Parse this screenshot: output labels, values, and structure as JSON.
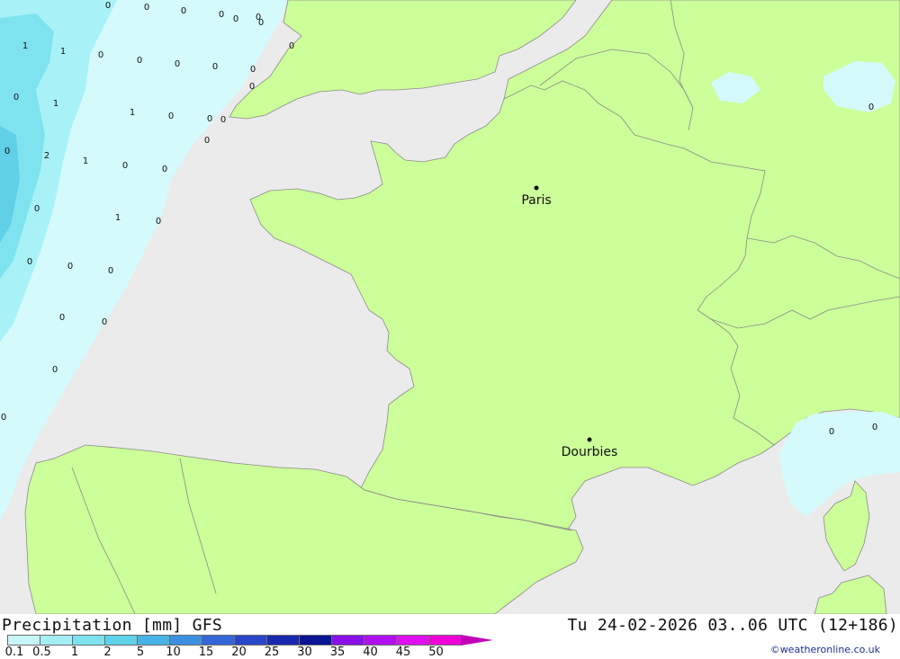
{
  "map": {
    "colors": {
      "sea": "#ebebeb",
      "land": "#ccff99",
      "precip_0_1": "#d4fafc",
      "precip_0_5": "#a8f2f7",
      "precip_1": "#7fe3ef",
      "precip_2": "#5fd0e6",
      "border": "#8a8a8a"
    },
    "cities": [
      {
        "name": "Paris"
      },
      {
        "name": "Dourbies"
      }
    ],
    "precip_values": [
      "0",
      "0",
      "0",
      "0",
      "0",
      "0",
      "1",
      "1",
      "0",
      "0",
      "0",
      "0",
      "0",
      "1",
      "1",
      "0",
      "0",
      "0",
      "2",
      "1",
      "0",
      "0",
      "0",
      "1",
      "0",
      "0",
      "0",
      "0",
      "0",
      "0",
      "0",
      "0",
      "0",
      "0",
      "0",
      "0",
      "0",
      "0",
      "0",
      "0",
      "0"
    ]
  },
  "legend": {
    "title": "Precipitation [mm] GFS",
    "time": "Tu 24-02-2026 03..06 UTC (12+186)",
    "ticks": [
      "0.1",
      "0.5",
      "1",
      "2",
      "5",
      "10",
      "15",
      "20",
      "25",
      "30",
      "35",
      "40",
      "45",
      "50"
    ],
    "scale_colors": [
      "#c6f6fa",
      "#a4eef5",
      "#7fe3ef",
      "#5fd3ea",
      "#48b4e6",
      "#3c8fe0",
      "#3466d8",
      "#2a46c8",
      "#1a28b0",
      "#0a1496",
      "#8a10e8",
      "#b010f0",
      "#e010f0",
      "#f000d8",
      "#c000b8"
    ],
    "credit": "©weatheronline.co.uk"
  }
}
